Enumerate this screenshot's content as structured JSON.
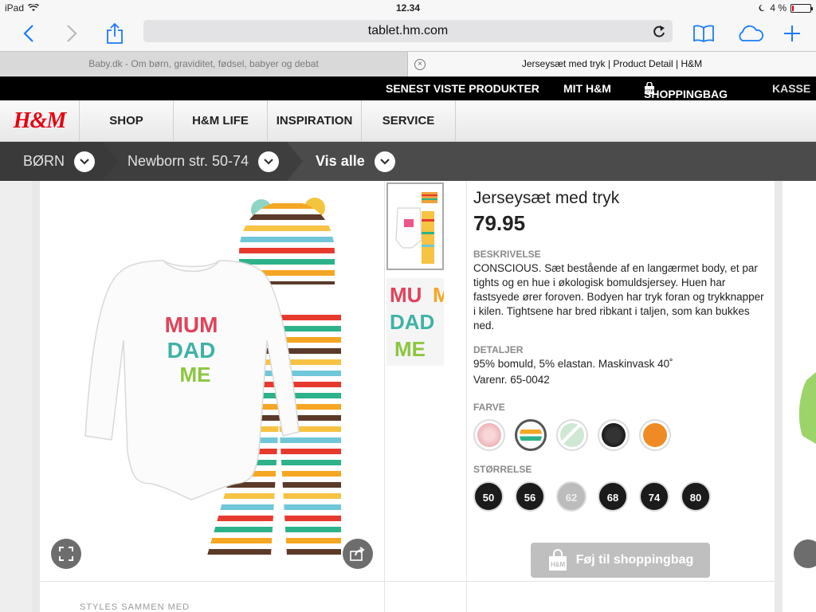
{
  "status_bar": {
    "device": "iPad",
    "time": "12.34",
    "battery": "4 %"
  },
  "browser": {
    "url": "tablet.hm.com",
    "tabs": [
      {
        "label": "Baby.dk - Om børn, graviditet, fødsel, babyer og debat"
      },
      {
        "label": "Jerseysæt med tryk | Product Detail | H&M"
      }
    ],
    "icons": [
      "back-icon",
      "forward-icon",
      "share-icon",
      "reload-icon",
      "bookmarks-icon",
      "icloud-tabs-icon",
      "new-tab-icon"
    ]
  },
  "top_bar": {
    "recent": "SENEST VISTE PRODUKTER",
    "my_hm": "MIT H&M",
    "bag": "SHOPPINGBAG",
    "checkout": "KASSE"
  },
  "nav": {
    "logo": "H&M",
    "items": [
      "SHOP",
      "H&M LIFE",
      "INSPIRATION",
      "SERVICE"
    ]
  },
  "breadcrumbs": [
    {
      "label": "BØRN"
    },
    {
      "label": "Newborn str. 50-74"
    },
    {
      "label": "Vis alle"
    }
  ],
  "product": {
    "title": "Jerseysæt med tryk",
    "price": "79.95",
    "description_heading": "BESKRIVELSE",
    "description": "CONSCIOUS. Sæt bestående af en langærmet body, et par tights og en hue i økologisk bomuldsjersey. Huen har fastsyede ører foroven. Bodyen har tryk foran og trykknapper i kilen. Tightsene har bred ribkant i taljen, som kan bukkes ned.",
    "details_heading": "DETALJER",
    "details_line1": "95% bomuld, 5% elastan. Maskinvask 40˚",
    "details_line2": "Varenr. 65-0042",
    "color_heading": "FARVE",
    "colors": [
      {
        "name": "light-pink-pattern",
        "hex": "#f3c6c9"
      },
      {
        "name": "multi-stripe",
        "hex": "#e98a2b"
      },
      {
        "name": "mint-stripe",
        "hex": "#cfe8d4"
      },
      {
        "name": "black-pattern",
        "hex": "#222222"
      },
      {
        "name": "orange",
        "hex": "#f08a24"
      }
    ],
    "selected_color": 1,
    "size_heading": "STØRRELSE",
    "sizes": [
      {
        "label": "50",
        "available": true
      },
      {
        "label": "56",
        "available": true
      },
      {
        "label": "62",
        "available": false
      },
      {
        "label": "68",
        "available": true
      },
      {
        "label": "74",
        "available": true
      },
      {
        "label": "80",
        "available": true
      }
    ],
    "add_to_bag": "Føj til shoppingbag",
    "print_text": [
      "MUM",
      "DAD",
      "ME"
    ]
  },
  "below_fold": "STYLES SAMMEN MED"
}
